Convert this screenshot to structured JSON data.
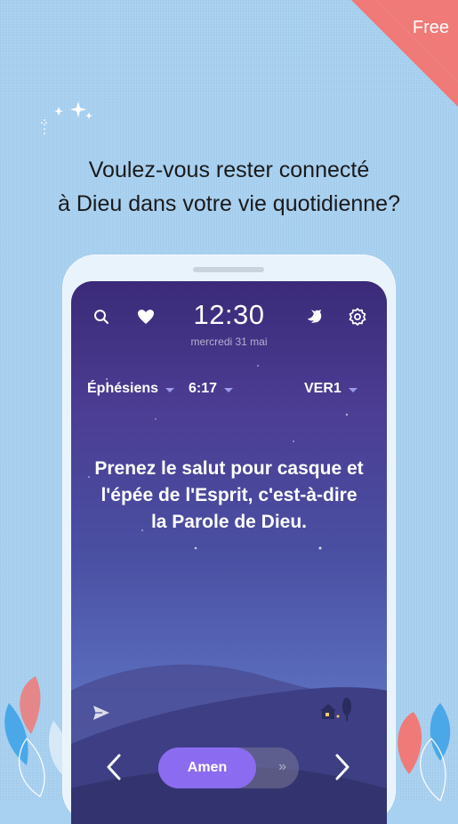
{
  "badge": {
    "label": "Free"
  },
  "headline": {
    "line1": "Voulez-vous rester connecté",
    "line2": "à Dieu dans votre vie quotidienne?"
  },
  "screen": {
    "time": "12:30",
    "date": "mercredi 31 mai",
    "book": "Éphésiens",
    "chapter_verse": "6:17",
    "version": "VER1",
    "verse_lines": [
      "Prenez le salut pour casque et",
      "l'épée de l'Esprit, c'est-à-dire",
      "la Parole de Dieu."
    ],
    "amen_label": "Amen",
    "amen_hint": "»"
  },
  "icons": {
    "search": "search-icon",
    "heart": "heart-icon",
    "dove": "dove-icon",
    "settings": "gear-icon",
    "send": "send-icon",
    "prev": "chevron-left-icon",
    "next": "chevron-right-icon"
  },
  "colors": {
    "background": "#a8d0f0",
    "badge": "#f07a78",
    "amen": "#8b6cf0",
    "screen_top": "#3a2a78"
  }
}
